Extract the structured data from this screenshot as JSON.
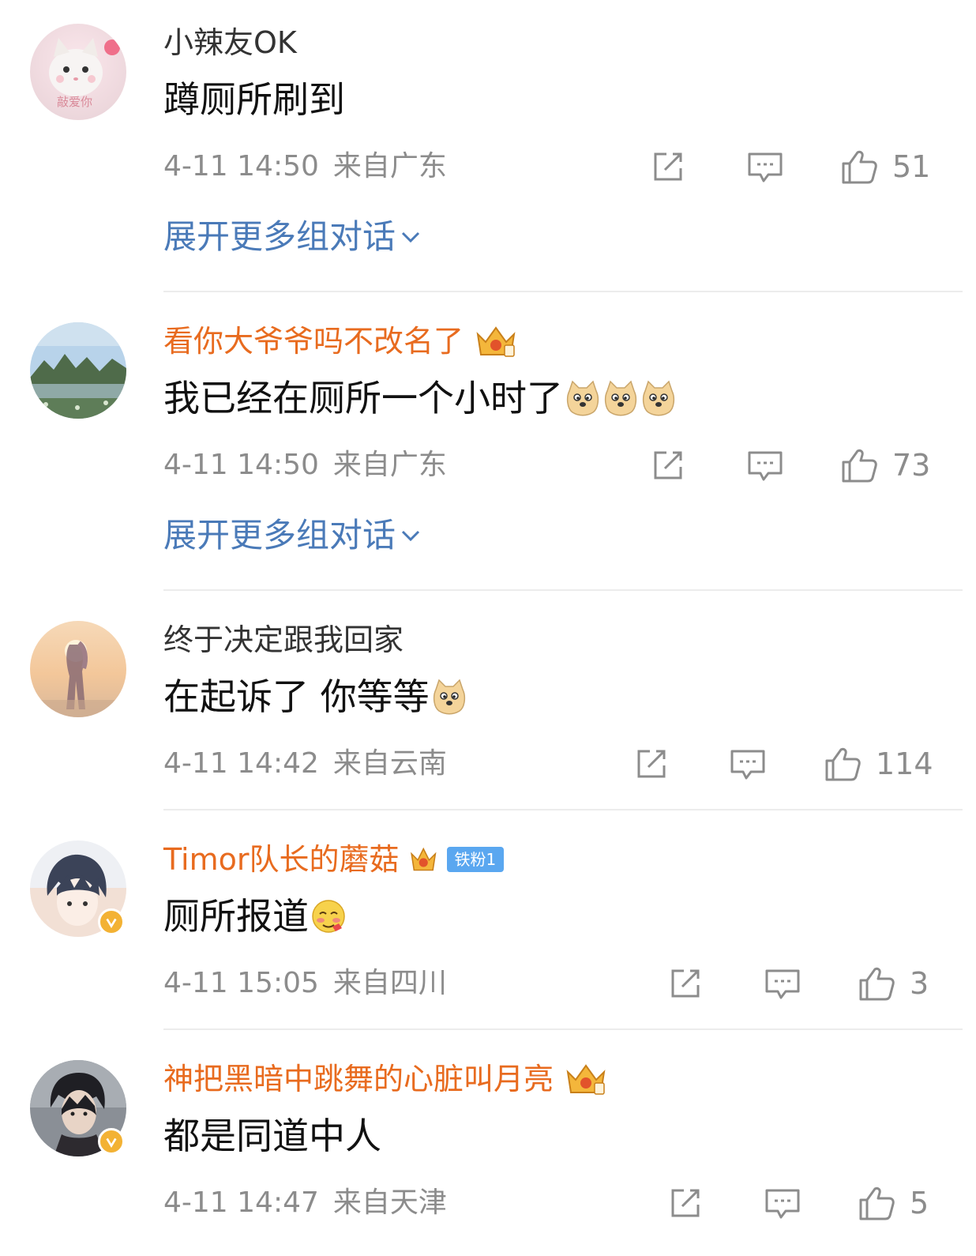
{
  "comments": [
    {
      "username": "小辣友OK",
      "content": "蹲厕所刷到",
      "time": "4-11 14:50",
      "location": "来自广东",
      "likes": "51",
      "expand": "展开更多组对话",
      "avatar_text": "敲爱你"
    },
    {
      "username": "看你大爷爷吗不改名了",
      "content": "我已经在厕所一个小时了",
      "time": "4-11 14:50",
      "location": "来自广东",
      "likes": "73",
      "expand": "展开更多组对话"
    },
    {
      "username": "终于决定跟我回家",
      "content": "在起诉了 你等等",
      "time": "4-11 14:42",
      "location": "来自云南",
      "likes": "114"
    },
    {
      "username": "Timor队长的蘑菇",
      "fan_badge": "铁粉1",
      "content": "厕所报道",
      "time": "4-11 15:05",
      "location": "来自四川",
      "likes": "3"
    },
    {
      "username": "神把黑暗中跳舞的心脏叫月亮",
      "content": "都是同道中人",
      "time": "4-11 14:47",
      "location": "来自天津",
      "likes": "5"
    }
  ],
  "colors": {
    "vip_name": "#e86b1f",
    "link": "#4a7ab8",
    "meta": "#8c8c8c",
    "fan_badge": "#5aa7f0",
    "verified": "#f3b234"
  },
  "icons": [
    "share-icon",
    "comment-icon",
    "like-icon",
    "crown-icon",
    "doge-emoji",
    "blush-emoji",
    "chevron-down-icon",
    "verified-badge-icon"
  ]
}
